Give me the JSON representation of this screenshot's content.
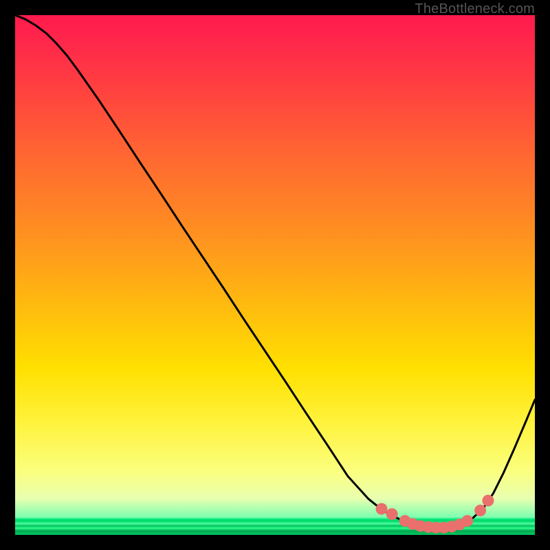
{
  "watermark": "TheBottleneck.com",
  "colors": {
    "background": "#000000",
    "curve_stroke": "#000000",
    "marker_fill": "#e9706c",
    "marker_stroke": "#e9706c",
    "gradient_top": "#ff1a4d",
    "gradient_mid": "#ffe000",
    "gradient_bottom_band": "#00e676"
  },
  "chart_data": {
    "type": "line",
    "title": "",
    "xlabel": "",
    "ylabel": "",
    "xlim": [
      0,
      100
    ],
    "ylim": [
      0,
      100
    ],
    "x": [
      0,
      2,
      4,
      6,
      8,
      10,
      12,
      16,
      20,
      24,
      28,
      32,
      36,
      40,
      44,
      48,
      52,
      56,
      60,
      64,
      68,
      70,
      72,
      74,
      76,
      78,
      80,
      82,
      84,
      86,
      88,
      90,
      92,
      94,
      96,
      98,
      100
    ],
    "y": [
      100,
      99.2,
      98.0,
      96.5,
      94.5,
      92.2,
      89.5,
      83.8,
      77.8,
      71.7,
      65.7,
      59.6,
      53.6,
      47.6,
      41.5,
      35.5,
      29.5,
      23.4,
      17.4,
      11.3,
      6.9,
      5.3,
      4.0,
      3.0,
      2.2,
      1.7,
      1.4,
      1.4,
      1.6,
      2.2,
      3.2,
      5.0,
      8.0,
      12.0,
      16.5,
      21.2,
      26.0
    ],
    "markers": {
      "x": [
        70.5,
        72.5,
        75.0,
        76.5,
        78.0,
        79.5,
        81.0,
        82.5,
        84.0,
        85.5,
        87.0,
        89.5,
        91.0
      ],
      "y": [
        5.0,
        4.0,
        2.7,
        2.1,
        1.7,
        1.5,
        1.4,
        1.4,
        1.6,
        2.0,
        2.7,
        4.7,
        6.6
      ]
    }
  }
}
